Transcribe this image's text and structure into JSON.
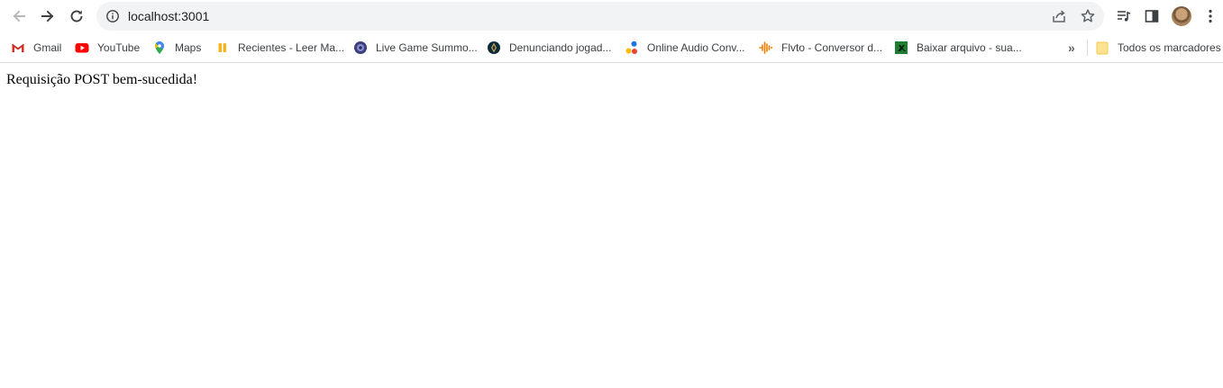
{
  "browser": {
    "address_bar": {
      "url": "localhost:3001"
    }
  },
  "bookmarks": [
    {
      "label": "Gmail",
      "icon": "gmail-icon"
    },
    {
      "label": "YouTube",
      "icon": "youtube-icon"
    },
    {
      "label": "Maps",
      "icon": "maps-icon"
    },
    {
      "label": "Recientes - Leer Ma...",
      "icon": "bookmark-favicon-icon"
    },
    {
      "label": "Live Game Summo...",
      "icon": "bookmark-favicon-icon"
    },
    {
      "label": "Denunciando jogad...",
      "icon": "bookmark-favicon-icon"
    },
    {
      "label": "Online Audio Conv...",
      "icon": "bookmark-favicon-icon"
    },
    {
      "label": "Flvto - Conversor d...",
      "icon": "bookmark-favicon-icon"
    },
    {
      "label": "Baixar arquivo - sua...",
      "icon": "bookmark-favicon-icon"
    }
  ],
  "bookmarks_overflow": "»",
  "all_bookmarks": {
    "label": "Todos os marcadores",
    "icon": "folder-icon"
  },
  "page": {
    "message": "Requisição POST bem-sucedida!"
  },
  "colors": {
    "toolbar_bg": "#ffffff",
    "omnibox_bg": "#f1f3f4",
    "icon": "#5f6368",
    "text": "#3c4043"
  }
}
